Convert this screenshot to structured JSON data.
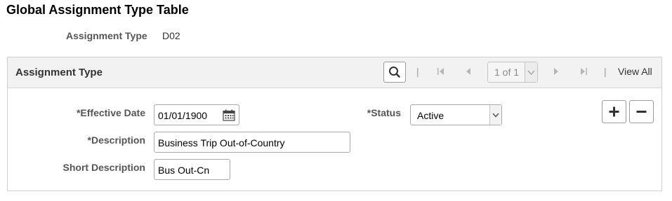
{
  "page": {
    "title": "Global Assignment Type Table",
    "key_label": "Assignment Type",
    "key_value": "D02"
  },
  "panel": {
    "title": "Assignment Type",
    "pager_text": "1 of 1",
    "view_all": "View All",
    "separator": "|",
    "icons": [
      "search-icon",
      "first-page-icon",
      "previous-icon",
      "next-icon",
      "last-page-icon",
      "plus-icon",
      "minus-icon",
      "calendar-icon"
    ]
  },
  "form": {
    "effective_date_label": "*Effective Date",
    "effective_date_value": "01/01/1900",
    "status_label": "*Status",
    "status_value": "Active",
    "description_label": "*Description",
    "description_value": "Business Trip Out-of-Country",
    "short_description_label": "Short Description",
    "short_description_value": "Bus Out-Cn"
  },
  "colors": {
    "header_bg": "#f2f2f2",
    "border": "#cfcfcf",
    "label": "#555555",
    "disabled": "#8a8a8a"
  }
}
